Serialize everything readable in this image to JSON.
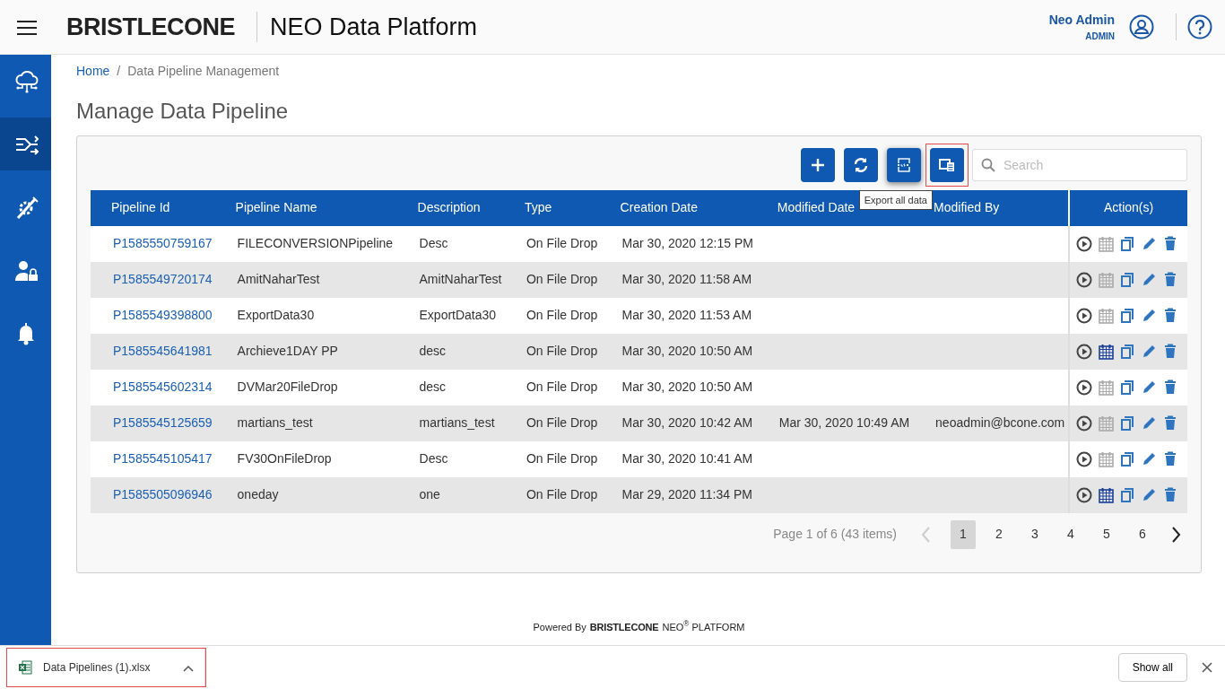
{
  "header": {
    "logo": "BRISTLECONE",
    "app_title": "NEO Data Platform",
    "user_name": "Neo Admin",
    "user_role": "ADMIN"
  },
  "sidebar": {
    "items": [
      {
        "kind": "cloud",
        "selected": false
      },
      {
        "kind": "pipeline",
        "selected": true
      },
      {
        "kind": "tools",
        "selected": false
      },
      {
        "kind": "user-lock",
        "selected": false
      },
      {
        "kind": "bell",
        "selected": false
      }
    ]
  },
  "breadcrumb_separator": "/",
  "breadcrumb": [
    {
      "label": "Home",
      "link": true
    },
    {
      "label": "Data Pipeline Management",
      "link": false
    }
  ],
  "page_title": "Manage Data Pipeline",
  "toolbar": {
    "buttons": [
      {
        "kind": "add",
        "highlighted": false
      },
      {
        "kind": "refresh",
        "highlighted": false
      },
      {
        "kind": "xlsx",
        "highlighted": false
      },
      {
        "kind": "export",
        "highlighted": true
      }
    ],
    "tooltip": "Export all data",
    "search": {
      "placeholder": "Search"
    }
  },
  "table": {
    "columns": [
      "Pipeline Id",
      "Pipeline Name",
      "Description",
      "Type",
      "Creation Date",
      "Modified Date",
      "Modified By",
      "Action(s)"
    ],
    "rows": [
      {
        "id": "P1585550759167",
        "name": "FILECONVERSIONPipeline",
        "description": "Desc",
        "type": "On File Drop",
        "created": "Mar 30, 2020 12:15 PM",
        "modified": "",
        "modified_by": "",
        "scheduled": false
      },
      {
        "id": "P1585549720174",
        "name": "AmitNaharTest",
        "description": "AmitNaharTest",
        "type": "On File Drop",
        "created": "Mar 30, 2020 11:58 AM",
        "modified": "",
        "modified_by": "",
        "scheduled": false
      },
      {
        "id": "P1585549398800",
        "name": "ExportData30",
        "description": "ExportData30",
        "type": "On File Drop",
        "created": "Mar 30, 2020 11:53 AM",
        "modified": "",
        "modified_by": "",
        "scheduled": false
      },
      {
        "id": "P1585545641981",
        "name": "Archieve1DAY PP",
        "description": "desc",
        "type": "On File Drop",
        "created": "Mar 30, 2020 10:50 AM",
        "modified": "",
        "modified_by": "",
        "scheduled": true
      },
      {
        "id": "P1585545602314",
        "name": "DVMar20FileDrop",
        "description": "desc",
        "type": "On File Drop",
        "created": "Mar 30, 2020 10:50 AM",
        "modified": "",
        "modified_by": "",
        "scheduled": false
      },
      {
        "id": "P1585545125659",
        "name": "martians_test",
        "description": "martians_test",
        "type": "On File Drop",
        "created": "Mar 30, 2020 10:42 AM",
        "modified": "Mar 30, 2020 10:49 AM",
        "modified_by": "neoadmin@bcone.com",
        "scheduled": false
      },
      {
        "id": "P1585545105417",
        "name": "FV30OnFileDrop",
        "description": "Desc",
        "type": "On File Drop",
        "created": "Mar 30, 2020 10:41 AM",
        "modified": "",
        "modified_by": "",
        "scheduled": false
      },
      {
        "id": "P1585505096946",
        "name": "oneday",
        "description": "one",
        "type": "On File Drop",
        "created": "Mar 29, 2020 11:34 PM",
        "modified": "",
        "modified_by": "",
        "scheduled": true
      }
    ]
  },
  "pagination": {
    "summary": "Page 1 of 6 (43 items)",
    "pages": [
      {
        "label": "1",
        "selected": true
      },
      {
        "label": "2",
        "selected": false
      },
      {
        "label": "3",
        "selected": false
      },
      {
        "label": "4",
        "selected": false
      },
      {
        "label": "5",
        "selected": false
      },
      {
        "label": "6",
        "selected": false
      }
    ],
    "prev_disabled": true,
    "next_disabled": false
  },
  "footer": {
    "powered_by": "Powered By",
    "logo": "BRISTLECONE",
    "platform": "NEO$^{®}$ PLATFORM"
  },
  "download_bar": {
    "file": "Data Pipelines (1).xlsx",
    "highlighted": true,
    "show_all": "Show all"
  }
}
